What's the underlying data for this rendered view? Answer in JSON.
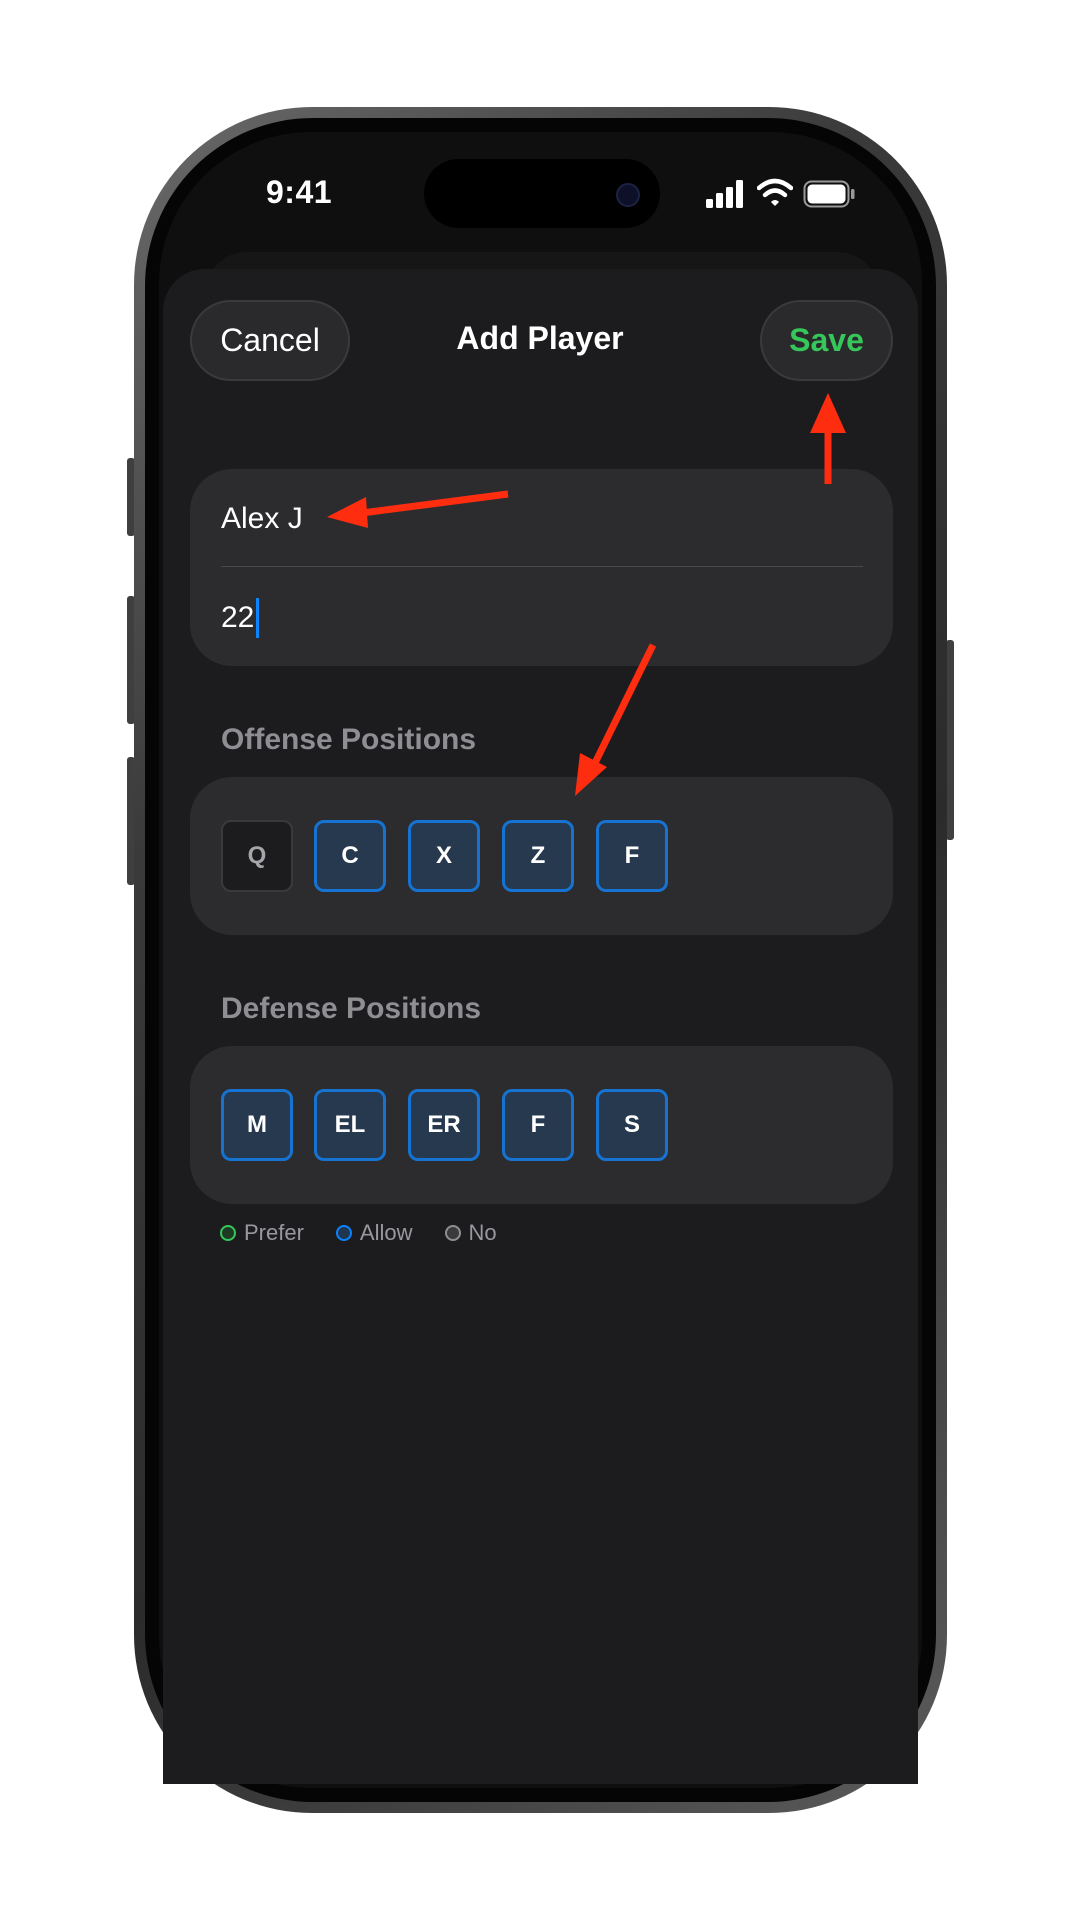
{
  "status_bar": {
    "time": "9:41"
  },
  "header": {
    "cancel_label": "Cancel",
    "title": "Add Player",
    "save_label": "Save"
  },
  "form": {
    "name_value": "Alex J",
    "number_value": "22"
  },
  "offense": {
    "label": "Offense Positions",
    "positions": [
      {
        "label": "Q",
        "state": "no"
      },
      {
        "label": "C",
        "state": "allow"
      },
      {
        "label": "X",
        "state": "allow"
      },
      {
        "label": "Z",
        "state": "allow"
      },
      {
        "label": "F",
        "state": "allow"
      }
    ]
  },
  "defense": {
    "label": "Defense Positions",
    "positions": [
      {
        "label": "M",
        "state": "allow"
      },
      {
        "label": "EL",
        "state": "allow"
      },
      {
        "label": "ER",
        "state": "allow"
      },
      {
        "label": "F",
        "state": "allow"
      },
      {
        "label": "S",
        "state": "allow"
      }
    ]
  },
  "legend": {
    "prefer": "Prefer",
    "allow": "Allow",
    "no": "No"
  },
  "colors": {
    "prefer": "#35c759",
    "allow": "#0a84ff",
    "no": "#8e8e93",
    "annotation_arrow": "#ff2d0f"
  }
}
